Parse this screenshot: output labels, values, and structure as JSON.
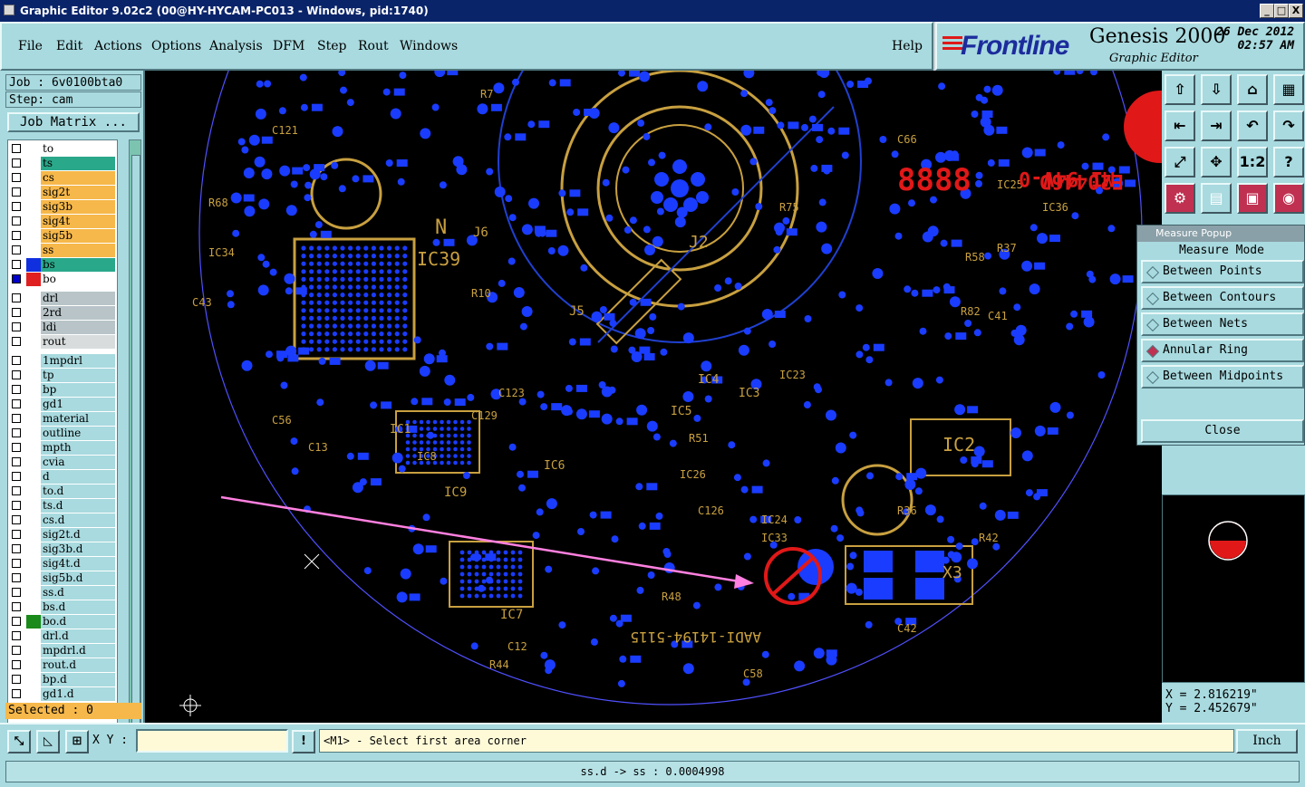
{
  "window": {
    "title": "Graphic Editor 9.02c2 (00@HY-HYCAM-PC013 - Windows, pid:1740)",
    "buttons": [
      "_",
      "□",
      "X"
    ]
  },
  "menu": {
    "items": [
      "File",
      "Edit",
      "Actions",
      "Options",
      "Analysis",
      "DFM",
      "Step",
      "Rout",
      "Windows"
    ],
    "help": "Help"
  },
  "brand": {
    "logo": "Frontline",
    "product": "Genesis 2000",
    "subtitle": "Graphic Editor",
    "date": "26 Dec 2012",
    "time": "02:57 AM"
  },
  "job": {
    "job_label": "Job : 6v0100bta0",
    "step_label": "Step: cam",
    "matrix_button": "Job Matrix ...",
    "selected": "Selected : 0"
  },
  "layers": [
    {
      "name": "to",
      "color": "#ffffff",
      "swatch": ""
    },
    {
      "name": "ts",
      "color": "#2aa88a",
      "swatch": ""
    },
    {
      "name": "cs",
      "color": "#f6b84a",
      "swatch": ""
    },
    {
      "name": "sig2t",
      "color": "#f6b84a",
      "swatch": ""
    },
    {
      "name": "sig3b",
      "color": "#f6b84a",
      "swatch": ""
    },
    {
      "name": "sig4t",
      "color": "#f6b84a",
      "swatch": ""
    },
    {
      "name": "sig5b",
      "color": "#f6b84a",
      "swatch": ""
    },
    {
      "name": "ss",
      "color": "#f6b84a",
      "swatch": ""
    },
    {
      "name": "bs",
      "color": "#2aa88a",
      "swatch": "#1030e0"
    },
    {
      "name": "bo",
      "color": "#ffffff",
      "swatch": "#e02020",
      "checked": true
    },
    {
      "name": "drl",
      "color": "#b8c4c8",
      "swatch": ""
    },
    {
      "name": "2rd",
      "color": "#b8c4c8",
      "swatch": ""
    },
    {
      "name": "ldi",
      "color": "#b8c4c8",
      "swatch": ""
    },
    {
      "name": "rout",
      "color": "#d8dcdc",
      "swatch": ""
    },
    {
      "name": "1mpdrl",
      "color": "#a8dadf",
      "swatch": ""
    },
    {
      "name": "tp",
      "color": "#a8dadf",
      "swatch": ""
    },
    {
      "name": "bp",
      "color": "#a8dadf",
      "swatch": ""
    },
    {
      "name": "gd1",
      "color": "#a8dadf",
      "swatch": ""
    },
    {
      "name": "material",
      "color": "#a8dadf",
      "swatch": ""
    },
    {
      "name": "outline",
      "color": "#a8dadf",
      "swatch": ""
    },
    {
      "name": "mpth",
      "color": "#a8dadf",
      "swatch": ""
    },
    {
      "name": "cvia",
      "color": "#a8dadf",
      "swatch": ""
    },
    {
      "name": "d",
      "color": "#a8dadf",
      "swatch": ""
    },
    {
      "name": "to.d",
      "color": "#a8dadf",
      "swatch": ""
    },
    {
      "name": "ts.d",
      "color": "#a8dadf",
      "swatch": ""
    },
    {
      "name": "cs.d",
      "color": "#a8dadf",
      "swatch": ""
    },
    {
      "name": "sig2t.d",
      "color": "#a8dadf",
      "swatch": ""
    },
    {
      "name": "sig3b.d",
      "color": "#a8dadf",
      "swatch": ""
    },
    {
      "name": "sig4t.d",
      "color": "#a8dadf",
      "swatch": ""
    },
    {
      "name": "sig5b.d",
      "color": "#a8dadf",
      "swatch": ""
    },
    {
      "name": "ss.d",
      "color": "#a8dadf",
      "swatch": ""
    },
    {
      "name": "bs.d",
      "color": "#a8dadf",
      "swatch": ""
    },
    {
      "name": "bo.d",
      "color": "#a8dadf",
      "swatch": "#1a8a1a"
    },
    {
      "name": "drl.d",
      "color": "#a8dadf",
      "swatch": ""
    },
    {
      "name": "mpdrl.d",
      "color": "#a8dadf",
      "swatch": ""
    },
    {
      "name": "rout.d",
      "color": "#a8dadf",
      "swatch": ""
    },
    {
      "name": "bp.d",
      "color": "#a8dadf",
      "swatch": ""
    },
    {
      "name": "gd1.d",
      "color": "#a8dadf",
      "swatch": ""
    }
  ],
  "pcb": {
    "silk_labels": [
      "IC39",
      "J2",
      "IC2",
      "J6",
      "J5",
      "IC9",
      "IC7",
      "IC3",
      "IC1",
      "IC4",
      "IC5",
      "IC6",
      "IC8",
      "IC23",
      "IC24",
      "IC25",
      "IC26",
      "IC33",
      "IC34",
      "IC36",
      "C41",
      "C42",
      "C43",
      "C56",
      "C58",
      "C66",
      "C12",
      "C13",
      "C121",
      "C123",
      "C126",
      "C129",
      "R7",
      "R10",
      "R36",
      "R37",
      "R42",
      "R44",
      "R48",
      "R51",
      "R58",
      "R68",
      "R75",
      "R82",
      "X3",
      "N"
    ],
    "marking_line1": "E20446D",
    "marking_line2": "MI 94V-0",
    "digits": "8888",
    "part_text": "AADI-14194-5115"
  },
  "measure_popup": {
    "title": "Measure Popup",
    "mode_label": "Measure Mode",
    "options": [
      "Between Points",
      "Between Contours",
      "Between Nets",
      "Annular Ring",
      "Between Midpoints"
    ],
    "selected_option": "Annular Ring",
    "close": "Close"
  },
  "toolbar_icons": [
    "home-icon",
    "save-icon",
    "open-icon",
    "layout-icon",
    "move-left-icon",
    "move-right-icon",
    "undo-icon",
    "redo-icon",
    "zoom-fit-icon",
    "pan-icon",
    "scale-icon",
    "help-icon",
    "measure-icon",
    "grid-icon",
    "snap-icon",
    "drill-icon"
  ],
  "toolbar_glyphs": [
    "⇧",
    "⇩",
    "⌂",
    "▦",
    "⇤",
    "⇥",
    "↶",
    "↷",
    "⤢",
    "✥",
    "1:2",
    "?",
    "⚙",
    "▤",
    "▣",
    "◉"
  ],
  "coords": {
    "x": "X = 2.816219\"",
    "y": "Y = 2.452679\""
  },
  "bottom": {
    "xy_label": "X Y :",
    "xy_value": "",
    "message": "<M1> - Select first area corner",
    "unit": "Inch",
    "status": "ss.d -> ss : 0.0004998"
  }
}
